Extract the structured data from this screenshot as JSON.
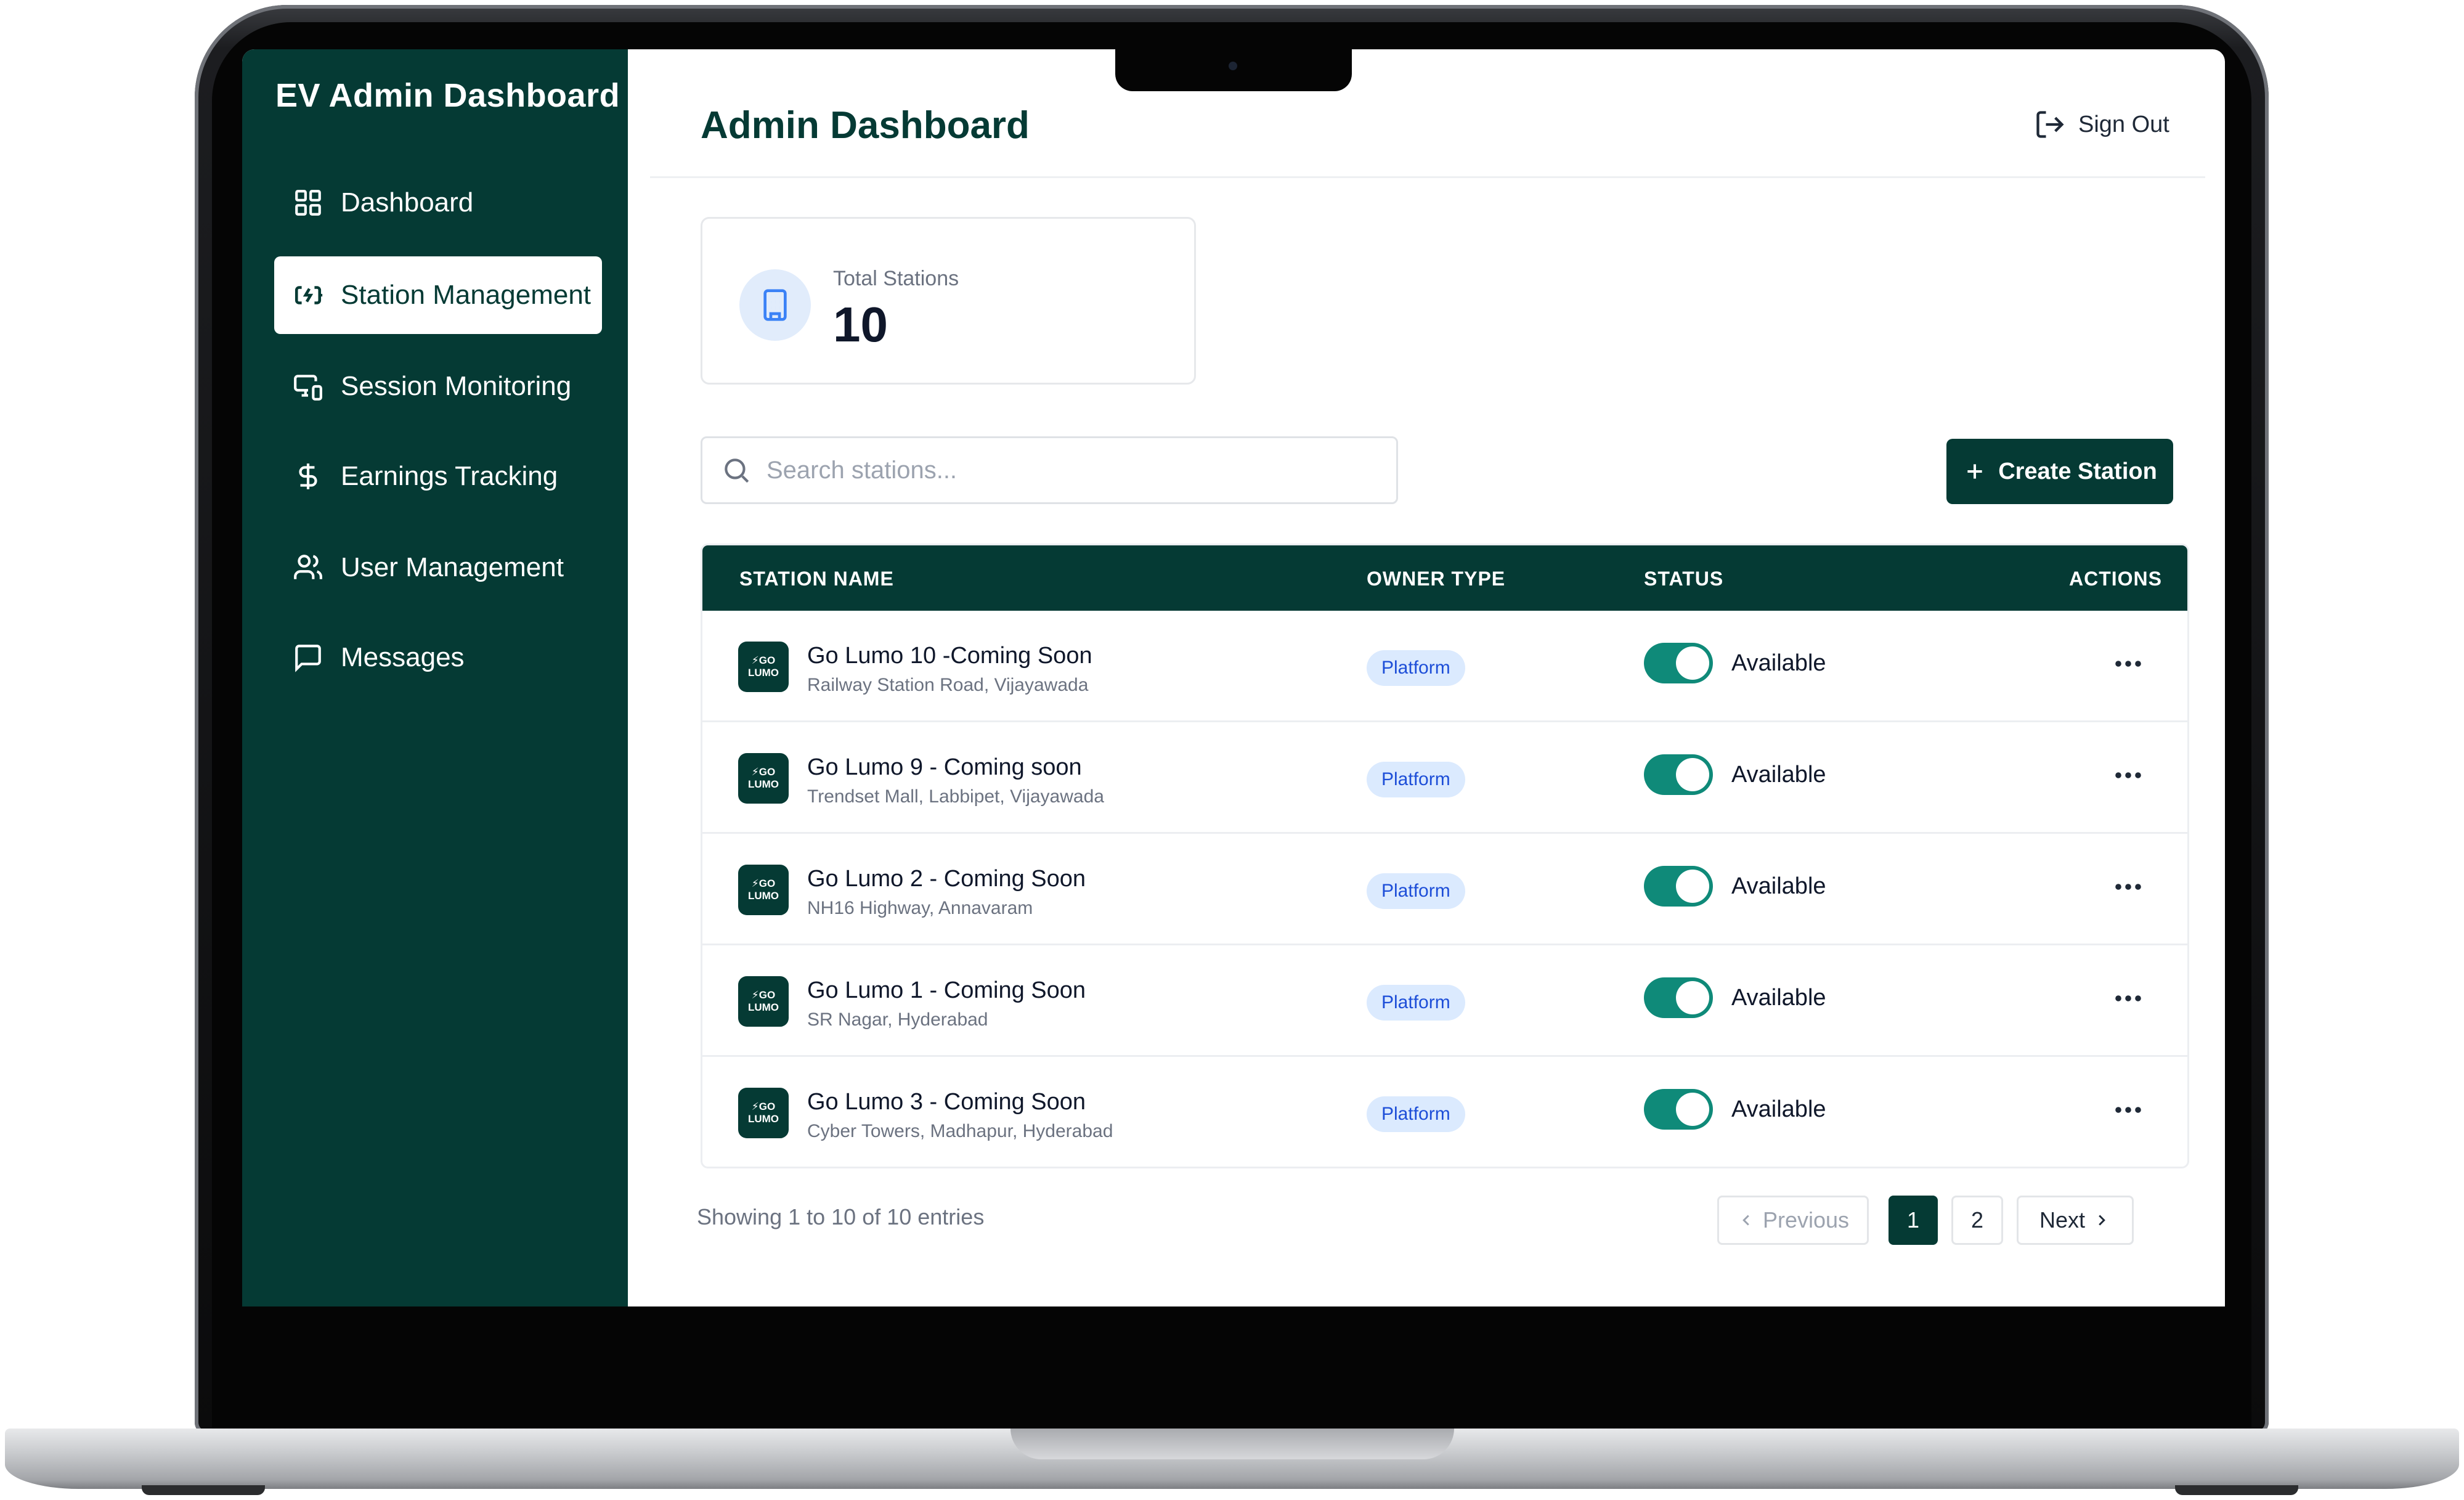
{
  "brand": {
    "title": "EV Admin Dashboard"
  },
  "sidebar": {
    "items": [
      {
        "label": "Dashboard",
        "icon": "grid-icon",
        "active": false
      },
      {
        "label": "Station Management",
        "icon": "charging-station-icon",
        "active": true
      },
      {
        "label": "Session Monitoring",
        "icon": "monitor-devices-icon",
        "active": false
      },
      {
        "label": "Earnings Tracking",
        "icon": "dollar-icon",
        "active": false
      },
      {
        "label": "User Management",
        "icon": "users-icon",
        "active": false
      },
      {
        "label": "Messages",
        "icon": "message-icon",
        "active": false
      }
    ]
  },
  "header": {
    "title": "Admin Dashboard",
    "signout_label": "Sign Out",
    "signout_icon": "logout-icon"
  },
  "stats": {
    "label": "Total Stations",
    "value": "10",
    "icon": "building-icon"
  },
  "search": {
    "placeholder": "Search stations...",
    "value": "",
    "icon": "search-icon"
  },
  "actions": {
    "create_label": "Create Station",
    "create_icon": "plus-icon"
  },
  "table": {
    "headers": {
      "name": "STATION NAME",
      "owner": "OWNER TYPE",
      "status": "STATUS",
      "actions": "ACTIONS"
    },
    "logo_text": {
      "top": "⚡GO",
      "bottom": "LUMO"
    },
    "rows": [
      {
        "name": "Go Lumo 10 -Coming Soon",
        "address": "Railway Station Road, Vijayawada",
        "owner_type": "Platform",
        "status": "Available"
      },
      {
        "name": "Go Lumo 9 - Coming soon",
        "address": "Trendset Mall, Labbipet, Vijayawada",
        "owner_type": "Platform",
        "status": "Available"
      },
      {
        "name": "Go Lumo 2 - Coming Soon",
        "address": "NH16 Highway, Annavaram",
        "owner_type": "Platform",
        "status": "Available"
      },
      {
        "name": "Go Lumo 1 - Coming Soon",
        "address": "SR Nagar, Hyderabad",
        "owner_type": "Platform",
        "status": "Available"
      },
      {
        "name": "Go Lumo 3 - Coming Soon",
        "address": "Cyber Towers, Madhapur, Hyderabad",
        "owner_type": "Platform",
        "status": "Available"
      }
    ]
  },
  "pagination": {
    "summary": "Showing 1 to 10 of 10 entries",
    "previous": "Previous",
    "next": "Next",
    "pages": [
      "1",
      "2"
    ],
    "current": "1"
  },
  "colors": {
    "brand_dark": "#053a34",
    "toggle_on": "#0f8a79",
    "badge_bg": "#dbeafe",
    "badge_text": "#1d4ed8"
  }
}
